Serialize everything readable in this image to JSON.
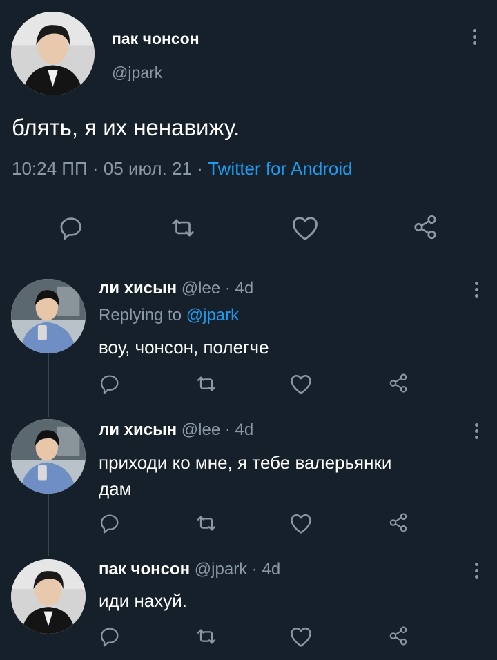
{
  "main_tweet": {
    "display_name": "пак чонсон",
    "handle": "@jpark",
    "text": "блять, я их ненавижу.",
    "time": "10:24 ПП",
    "date": "05 июл. 21",
    "source": "Twitter for Android",
    "separator": "·"
  },
  "replies": [
    {
      "display_name": "ли хисын",
      "handle": "@lee",
      "age": "4d",
      "separator": "·",
      "replying_prefix": "Replying to",
      "replying_handle": "@jpark",
      "text": "воу, чонсон, полегче"
    },
    {
      "display_name": "ли хисын",
      "handle": "@lee",
      "age": "4d",
      "separator": "·",
      "text_line1": "приходи ко мне, я тебе валерьянки",
      "text_line2": "дам"
    },
    {
      "display_name": "пак чонсон",
      "handle": "@jpark",
      "age": "4d",
      "separator": "·",
      "text": "иди нахуй."
    }
  ],
  "colors": {
    "background": "#15202b",
    "muted": "#8b98a5",
    "link": "#1d9bf0",
    "divider": "#38444d"
  },
  "icons": [
    "reply-icon",
    "retweet-icon",
    "like-icon",
    "share-icon",
    "more-options-icon"
  ]
}
